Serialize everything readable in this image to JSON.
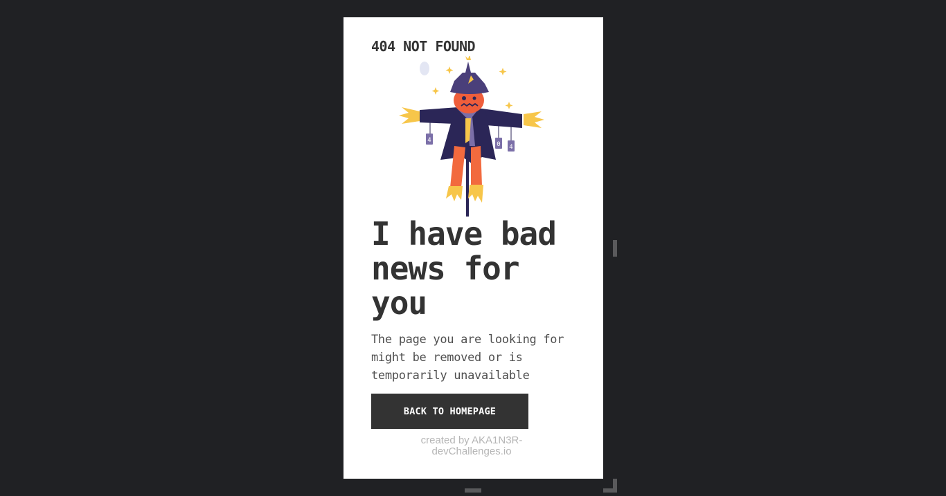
{
  "brand": {
    "title": "404 NOT FOUND"
  },
  "illustration": {
    "name": "scarecrow",
    "sign_digits": [
      "4",
      "0",
      "4"
    ],
    "colors": {
      "hat": "#4a3f7a",
      "head": "#ef5e3b",
      "coat": "#2b2657",
      "straw": "#f7c64a",
      "pants": "#f26a3e",
      "tags": "#7b6fa8",
      "moon": "#e3e6f3"
    }
  },
  "main": {
    "headline": "I have bad news for you",
    "message": "The page you are looking for might be removed or is temporarily unavailable",
    "button_label": "BACK TO HOMEPAGE"
  },
  "footer": {
    "credit_line1": "created by AKA1N3R-",
    "credit_line2": "devChallenges.io"
  },
  "colors": {
    "page_background": "#202124",
    "card_background": "#ffffff",
    "text_dark": "#333333",
    "button_background": "#333333",
    "credit_text": "#b5b5b5"
  }
}
